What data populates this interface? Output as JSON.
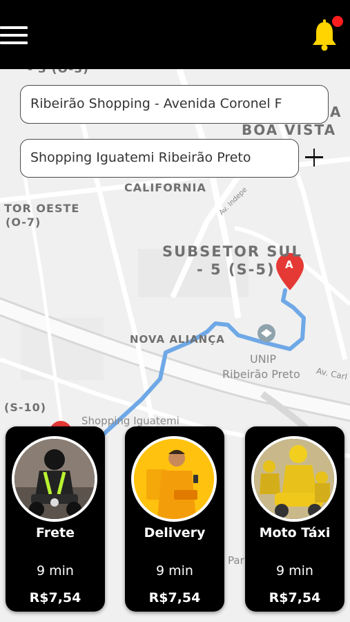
{
  "header": {
    "menu_icon": "hamburger-menu-icon",
    "notification_icon": "bell-icon",
    "bell_color": "#ffd400",
    "badge_color": "#ff1e1e"
  },
  "route": {
    "origin": "Ribeirão Shopping - Avenida Coronel F",
    "destination": "Shopping Iguatemi Ribeirão Preto",
    "add_stop_icon": "plus-icon",
    "route_color": "#6fa8e6"
  },
  "map": {
    "labels": {
      "top_partial": "- 3 (O-3)",
      "boa_vista_a": "A",
      "boa_vista": "BOA VISTA",
      "california": "CALIFORNIA",
      "setor_oeste": "TOR OESTE",
      "o7": "(O-7)",
      "subsetor_sul": "SUBSETOR SUL",
      "s5": "- 5 (S-5)",
      "nova_alianca": "NOVA ALIANÇA",
      "unip": "UNIP",
      "ribeirao_preto": "Ribeirão Preto",
      "av_carl": "Av. Carl",
      "av_indep": "Av. Indepe",
      "s10": "(S-10)",
      "shopping_iguatemi": "Shopping Iguatemi",
      "par": "Par"
    },
    "marker_a": "A",
    "marker_color": "#e53935"
  },
  "services": [
    {
      "name": "Frete",
      "time": "9 min",
      "price": "R$7,54"
    },
    {
      "name": "Delivery",
      "time": "9 min",
      "price": "R$7,54"
    },
    {
      "name": "Moto Táxi",
      "time": "9 min",
      "price": "R$7,54"
    }
  ]
}
